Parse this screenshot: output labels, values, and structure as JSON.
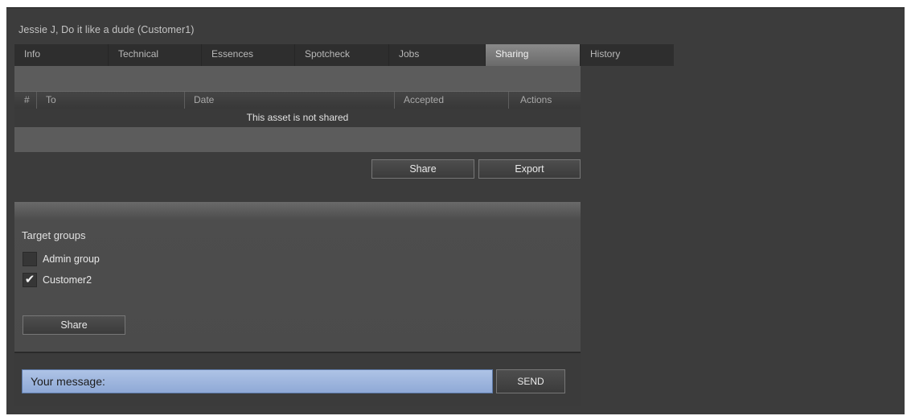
{
  "header": {
    "title": "Jessie J, Do it like a dude (Customer1)"
  },
  "tabs": [
    {
      "label": "Info"
    },
    {
      "label": "Technical"
    },
    {
      "label": "Essences"
    },
    {
      "label": "Spotcheck"
    },
    {
      "label": "Jobs"
    },
    {
      "label": "Sharing",
      "active": true
    },
    {
      "label": "History"
    }
  ],
  "table": {
    "columns": [
      "#",
      "To",
      "Date",
      "Accepted",
      "Actions"
    ],
    "empty_text": "This asset is not shared"
  },
  "actions": {
    "share_label": "Share",
    "export_label": "Export"
  },
  "target_groups": {
    "label": "Target groups",
    "groups": [
      {
        "name": "Admin group",
        "checked": false
      },
      {
        "name": "Customer2",
        "checked": true
      }
    ],
    "share_label": "Share"
  },
  "message": {
    "placeholder": "Your message:",
    "send_label": "SEND"
  },
  "colors": {
    "background": "#3c3c3c",
    "active_tab": "#7a7a7a",
    "message_input": "#9fb6dd"
  }
}
